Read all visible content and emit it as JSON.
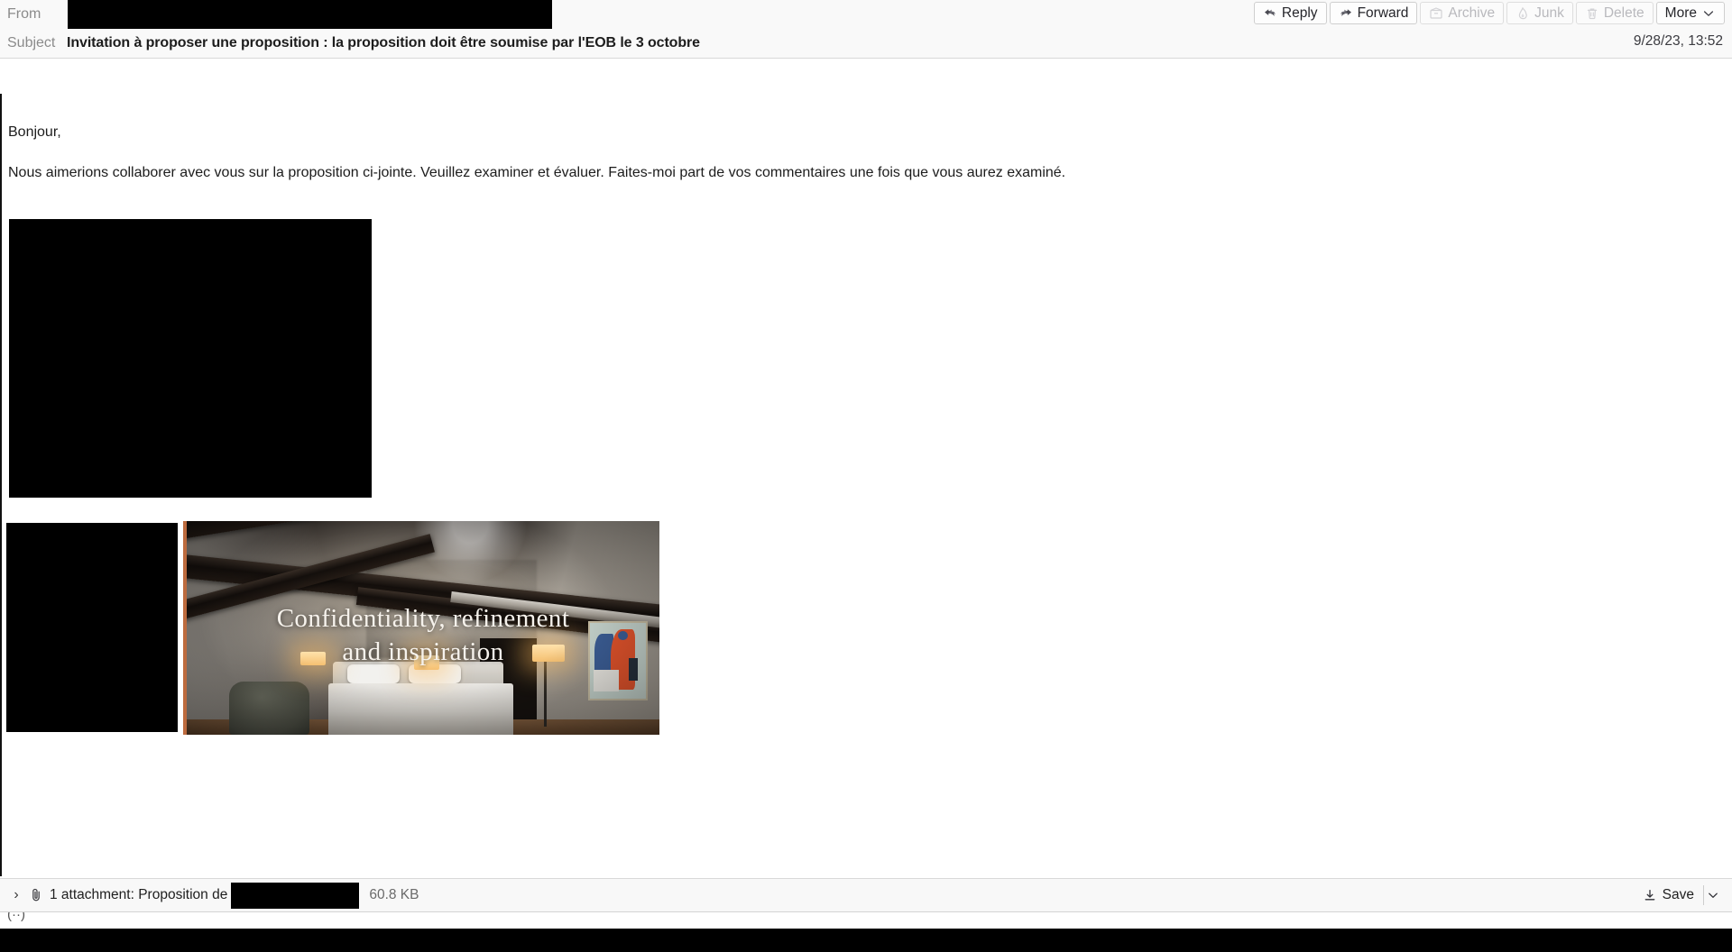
{
  "header": {
    "from_label": "From",
    "from_value_redacted": true,
    "subject_label": "Subject",
    "subject_value": "Invitation à proposer une proposition : la proposition doit être soumise par l'EOB le 3 octobre",
    "date": "9/28/23, 13:52",
    "toolbar": [
      {
        "name": "reply",
        "label": "Reply",
        "icon": "reply-arrow-icon",
        "disabled": false
      },
      {
        "name": "forward",
        "label": "Forward",
        "icon": "forward-arrow-icon",
        "disabled": false
      },
      {
        "name": "archive",
        "label": "Archive",
        "icon": "archive-box-icon",
        "disabled": true
      },
      {
        "name": "junk",
        "label": "Junk",
        "icon": "junk-flame-icon",
        "disabled": true
      },
      {
        "name": "delete",
        "label": "Delete",
        "icon": "trash-icon",
        "disabled": true
      },
      {
        "name": "more",
        "label": "More",
        "icon": "chevron-down-icon",
        "disabled": false
      }
    ]
  },
  "body": {
    "greeting": "Bonjour,",
    "paragraph": "Nous aimerions collaborer avec vous sur la proposition ci-jointe. Veuillez examiner et évaluer. Faites-moi part de vos commentaires une fois que vous aurez examiné.",
    "photo": {
      "overlay_line_1": "Confidentiality, refinement",
      "overlay_line_2": "and inspiration",
      "accent_color": "#bd6b3e"
    }
  },
  "attachment": {
    "expander_glyph": "›",
    "count_label": "1 attachment: Proposition de",
    "name_redacted": true,
    "size": "60.8 KB",
    "save_label": "Save",
    "save_icon": "download-icon",
    "dropdown_icon": "chevron-down-icon"
  },
  "bottom": {
    "clipped_text": "(··)"
  },
  "colors": {
    "header_bg": "#f9f9f9",
    "body_bg": "#ffffff",
    "attachment_bg": "#f8f8f8",
    "redaction": "#000000",
    "label_text": "#8b8b8b",
    "body_text": "#1c1c1c",
    "disabled_text": "#b9b9bd"
  }
}
